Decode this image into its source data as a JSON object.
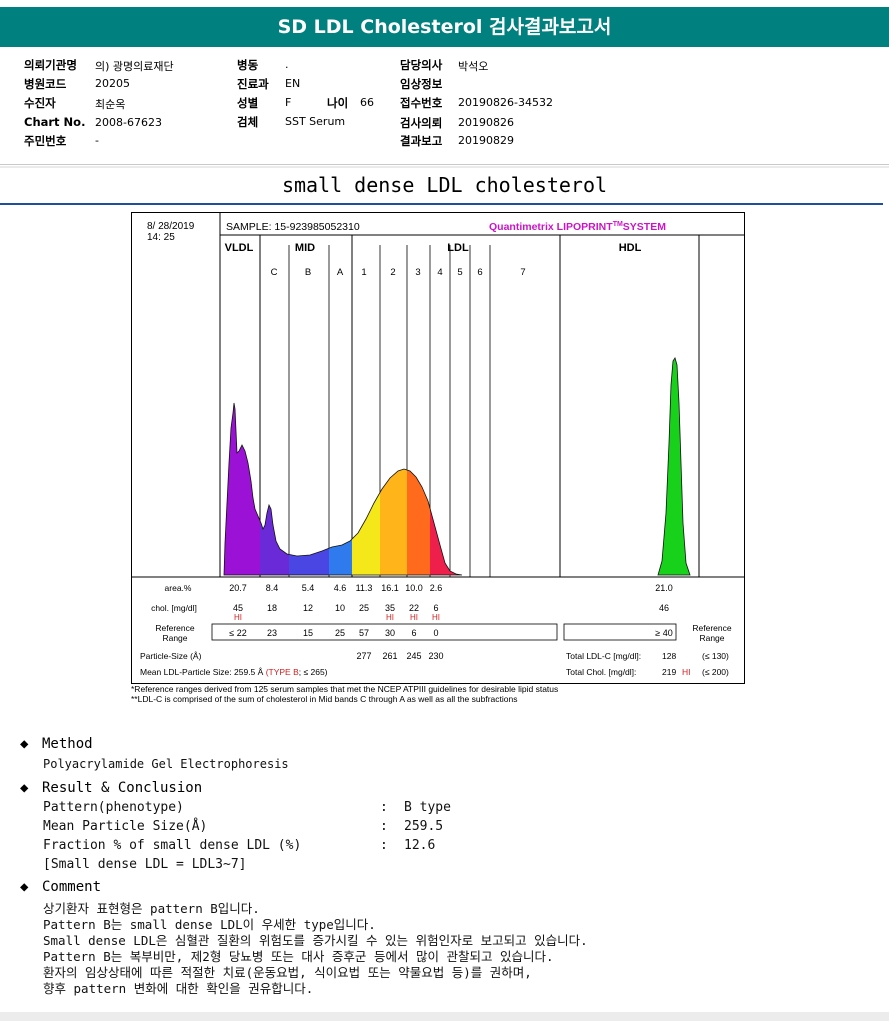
{
  "header": {
    "title": "SD LDL Cholesterol 검사결과보고서"
  },
  "patient": {
    "col1": [
      {
        "label": "의뢰기관명",
        "value": "의) 광명의료재단"
      },
      {
        "label": "병원코드",
        "value": "20205"
      },
      {
        "label": "수진자",
        "value": "최순옥"
      },
      {
        "label": "Chart No.",
        "value": "2008-67623"
      },
      {
        "label": "주민번호",
        "value": "-"
      }
    ],
    "col2": [
      {
        "label": "병동",
        "value": "."
      },
      {
        "label": "진료과",
        "value": "EN"
      },
      {
        "label": "성별",
        "value": "F"
      },
      {
        "label": "검체",
        "value": "SST Serum"
      }
    ],
    "age": {
      "label": "나이",
      "value": "66"
    },
    "col3": [
      {
        "label": "담당의사",
        "value": "박석오"
      },
      {
        "label": "임상정보",
        "value": ""
      },
      {
        "label": "접수번호",
        "value": "20190826-34532"
      },
      {
        "label": "검사의뢰",
        "value": "20190826"
      },
      {
        "label": "결과보고",
        "value": "20190829"
      }
    ]
  },
  "subtitle": "small dense LDL cholesterol",
  "figure": {
    "date": "8/ 28/2019",
    "time": "14: 25",
    "sample": "SAMPLE:   15-923985052310",
    "brand": "Quantimetrix LIPOPRINT",
    "brand_tm": "TM",
    "brand_suffix": "SYSTEM",
    "groups": [
      "VLDL",
      "MID",
      "LDL",
      "HDL"
    ],
    "bands": [
      "C",
      "B",
      "A",
      "1",
      "2",
      "3",
      "4",
      "5",
      "6",
      "7"
    ],
    "row_labels": {
      "area": "area.%",
      "chol": "chol. [mg/dl]",
      "ref1": "Reference",
      "ref2": "Range",
      "ref_right1": "Reference",
      "ref_right2": "Range",
      "psize": "Particle-Size (Å)",
      "mean": "Mean LDL-Particle Size:"
    },
    "area": [
      "20.7",
      "8.4",
      "5.4",
      "4.6",
      "11.3",
      "16.1",
      "10.0",
      "2.6",
      "21.0"
    ],
    "chol": [
      "45",
      "18",
      "12",
      "10",
      "25",
      "35",
      "22",
      "6",
      "46"
    ],
    "hi_flags": [
      "HI",
      "HI",
      "HI",
      "HI"
    ],
    "ref": [
      "≤ 22",
      "23",
      "15",
      "25",
      "57",
      "30",
      "6",
      "0",
      "≥ 40"
    ],
    "psize": [
      "277",
      "261",
      "245",
      "230"
    ],
    "mean_value": "259.5 Å",
    "mean_type": "(TYPE B",
    "mean_limit": "; ≤ 265)",
    "total_ldl_label": "Total LDL-C [mg/dl]:",
    "total_ldl_value": "128",
    "total_ldl_limit": "(≤ 130)",
    "total_chol_label": "Total Chol. [mg/dl]:",
    "total_chol_value": "219",
    "total_chol_flag": "HI",
    "total_chol_limit": "(≤ 200)",
    "colors": {
      "vldl": "#9b11d6",
      "mid": "#6a2ad8",
      "b": "#4a46e4",
      "a": "#2f7bee",
      "l1": "#f5e81a",
      "l2": "#ffb419",
      "l3": "#ff6a1c",
      "l4": "#ee1f4a",
      "hdl": "#17d11a"
    }
  },
  "footnotes": [
    "*Reference ranges derived from 125 serum samples that met the NCEP ATPIII guidelines for desirable lipid status",
    "**LDL-C is comprised of the sum of cholesterol in Mid bands C through A as well as all the subfractions"
  ],
  "method": {
    "heading": "Method",
    "text": "Polyacrylamide Gel Electrophoresis"
  },
  "result": {
    "heading": "Result & Conclusion",
    "rows": [
      {
        "label": "Pattern(phenotype)",
        "value": "B type"
      },
      {
        "label": "Mean Particle Size(Å)",
        "value": "259.5"
      },
      {
        "label": "Fraction % of small dense LDL (%)",
        "value": "12.6"
      }
    ],
    "note": "[Small dense LDL = LDL3~7]",
    "colon": ":"
  },
  "comment": {
    "heading": "Comment",
    "lines": [
      "상기환자 표현형은 pattern B입니다.",
      "Pattern B는 small dense LDL이 우세한 type입니다.",
      "Small dense LDL은 심혈관 질환의 위험도를 증가시킬 수 있는 위험인자로 보고되고 있습니다.",
      "Pattern B는 복부비만, 제2형 당뇨병 또는 대사 증후군 등에서 많이 관찰되고 있습니다.",
      "환자의 임상상태에 따른 적절한 치료(운동요법, 식이요법 또는 약물요법 등)를 권하며,",
      "향후 pattern 변화에 대한 확인을 권유합니다."
    ]
  },
  "diamond": "◆"
}
